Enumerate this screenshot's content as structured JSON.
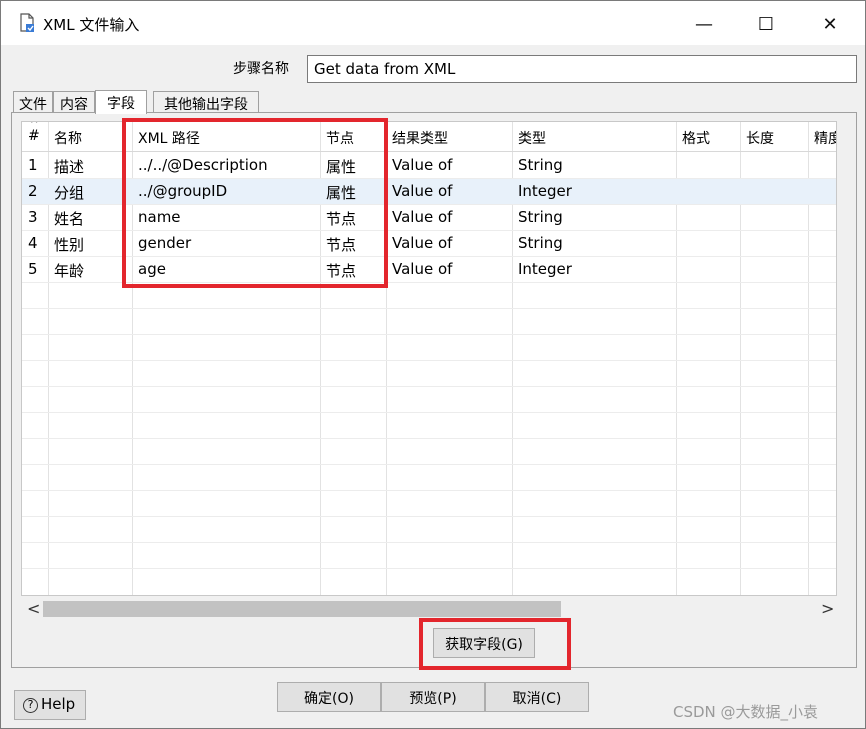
{
  "window": {
    "title": "XML 文件输入",
    "min_glyph": "—",
    "max_glyph": "☐",
    "close_glyph": "✕"
  },
  "step": {
    "label": "步骤名称",
    "value": "Get data from XML"
  },
  "tabs": [
    {
      "label": "文件"
    },
    {
      "label": "内容"
    },
    {
      "label": "字段"
    },
    {
      "label": "其他输出字段"
    }
  ],
  "active_tab": "字段",
  "table": {
    "columns": [
      "#",
      "名称",
      "XML 路径",
      "节点",
      "结果类型",
      "类型",
      "格式",
      "长度",
      "精度"
    ],
    "rows": [
      {
        "num": "1",
        "name": "描述",
        "path": "../../@Description",
        "node": "属性",
        "result": "Value of",
        "type": "String"
      },
      {
        "num": "2",
        "name": "分组",
        "path": "../@groupID",
        "node": "属性",
        "result": "Value of",
        "type": "Integer"
      },
      {
        "num": "3",
        "name": "姓名",
        "path": "name",
        "node": "节点",
        "result": "Value of",
        "type": "String"
      },
      {
        "num": "4",
        "name": "性别",
        "path": "gender",
        "node": "节点",
        "result": "Value of",
        "type": "String"
      },
      {
        "num": "5",
        "name": "年龄",
        "path": "age",
        "node": "节点",
        "result": "Value of",
        "type": "Integer"
      }
    ],
    "selected_row": 2
  },
  "scroll": {
    "left": "<",
    "right": ">"
  },
  "buttons": {
    "get_fields": "获取字段(G)",
    "ok": "确定(O)",
    "preview": "预览(P)",
    "cancel": "取消(C)",
    "help": "Help"
  },
  "watermark": "CSDN @大数据_小袁",
  "colors": {
    "highlight_box": "#e3262d",
    "selected_row": "#e8f1fa"
  }
}
